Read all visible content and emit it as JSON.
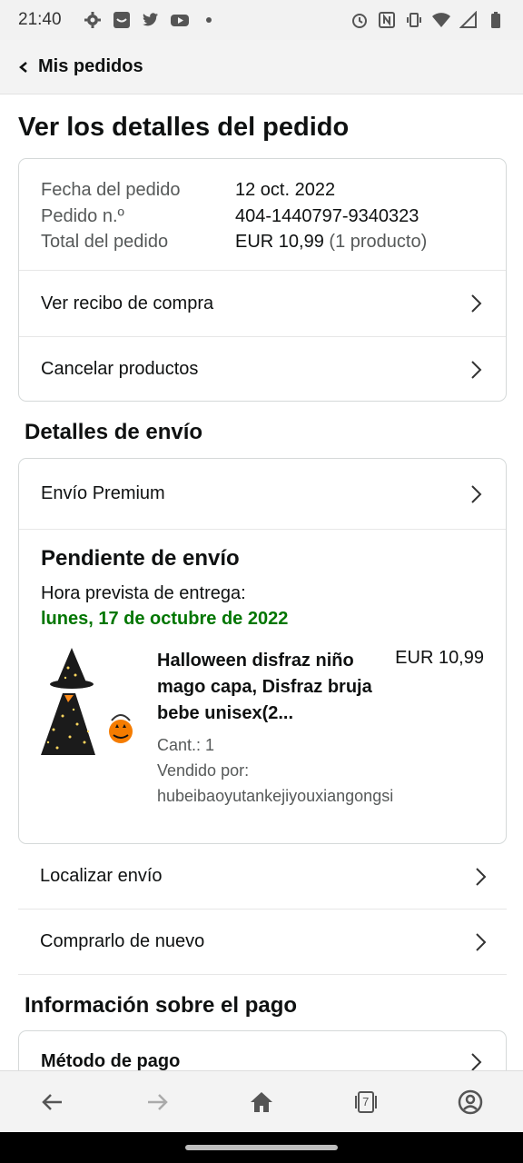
{
  "status_bar": {
    "time": "21:40"
  },
  "nav": {
    "title": "Mis pedidos"
  },
  "page": {
    "title": "Ver los detalles del pedido"
  },
  "summary": {
    "rows": [
      {
        "label": "Fecha del pedido",
        "value": "12 oct. 2022",
        "extra": ""
      },
      {
        "label": "Pedido n.º",
        "value": "404-1440797-9340323",
        "extra": ""
      },
      {
        "label": "Total del pedido",
        "value": "EUR 10,99",
        "extra": "(1 producto)"
      }
    ],
    "receipt_label": "Ver recibo de compra",
    "cancel_label": "Cancelar productos"
  },
  "shipping": {
    "section_title": "Detalles de envío",
    "method": "Envío Premium",
    "status": "Pendiente de envío",
    "eta_label": "Hora prevista de entrega:",
    "eta_date": "lunes, 17 de octubre de 2022",
    "product": {
      "title": "Halloween disfraz niño mago capa, Disfraz bruja bebe unisex(2...",
      "price": "EUR 10,99",
      "qty": "Cant.: 1",
      "seller_label": "Vendido por:",
      "seller": "hubeibaoyutankejiyouxiangongsi"
    },
    "track_label": "Localizar envío",
    "buy_again_label": "Comprarlo de nuevo"
  },
  "payment": {
    "section_title": "Información sobre el pago",
    "method_label": "Método de pago"
  },
  "bottom_nav": {
    "tab_count": "7"
  },
  "colors": {
    "eta_green": "#007600",
    "muted_text": "#565959",
    "border": "#d5d9d9"
  },
  "icons": [
    "settings-icon",
    "app-icon",
    "twitter-icon",
    "youtube-icon",
    "alarm-icon",
    "nfc-icon",
    "vibrate-icon",
    "wifi-icon",
    "signal-icon",
    "battery-icon",
    "back-arrow-icon",
    "forward-arrow-icon",
    "home-icon",
    "tabs-icon",
    "account-icon"
  ]
}
